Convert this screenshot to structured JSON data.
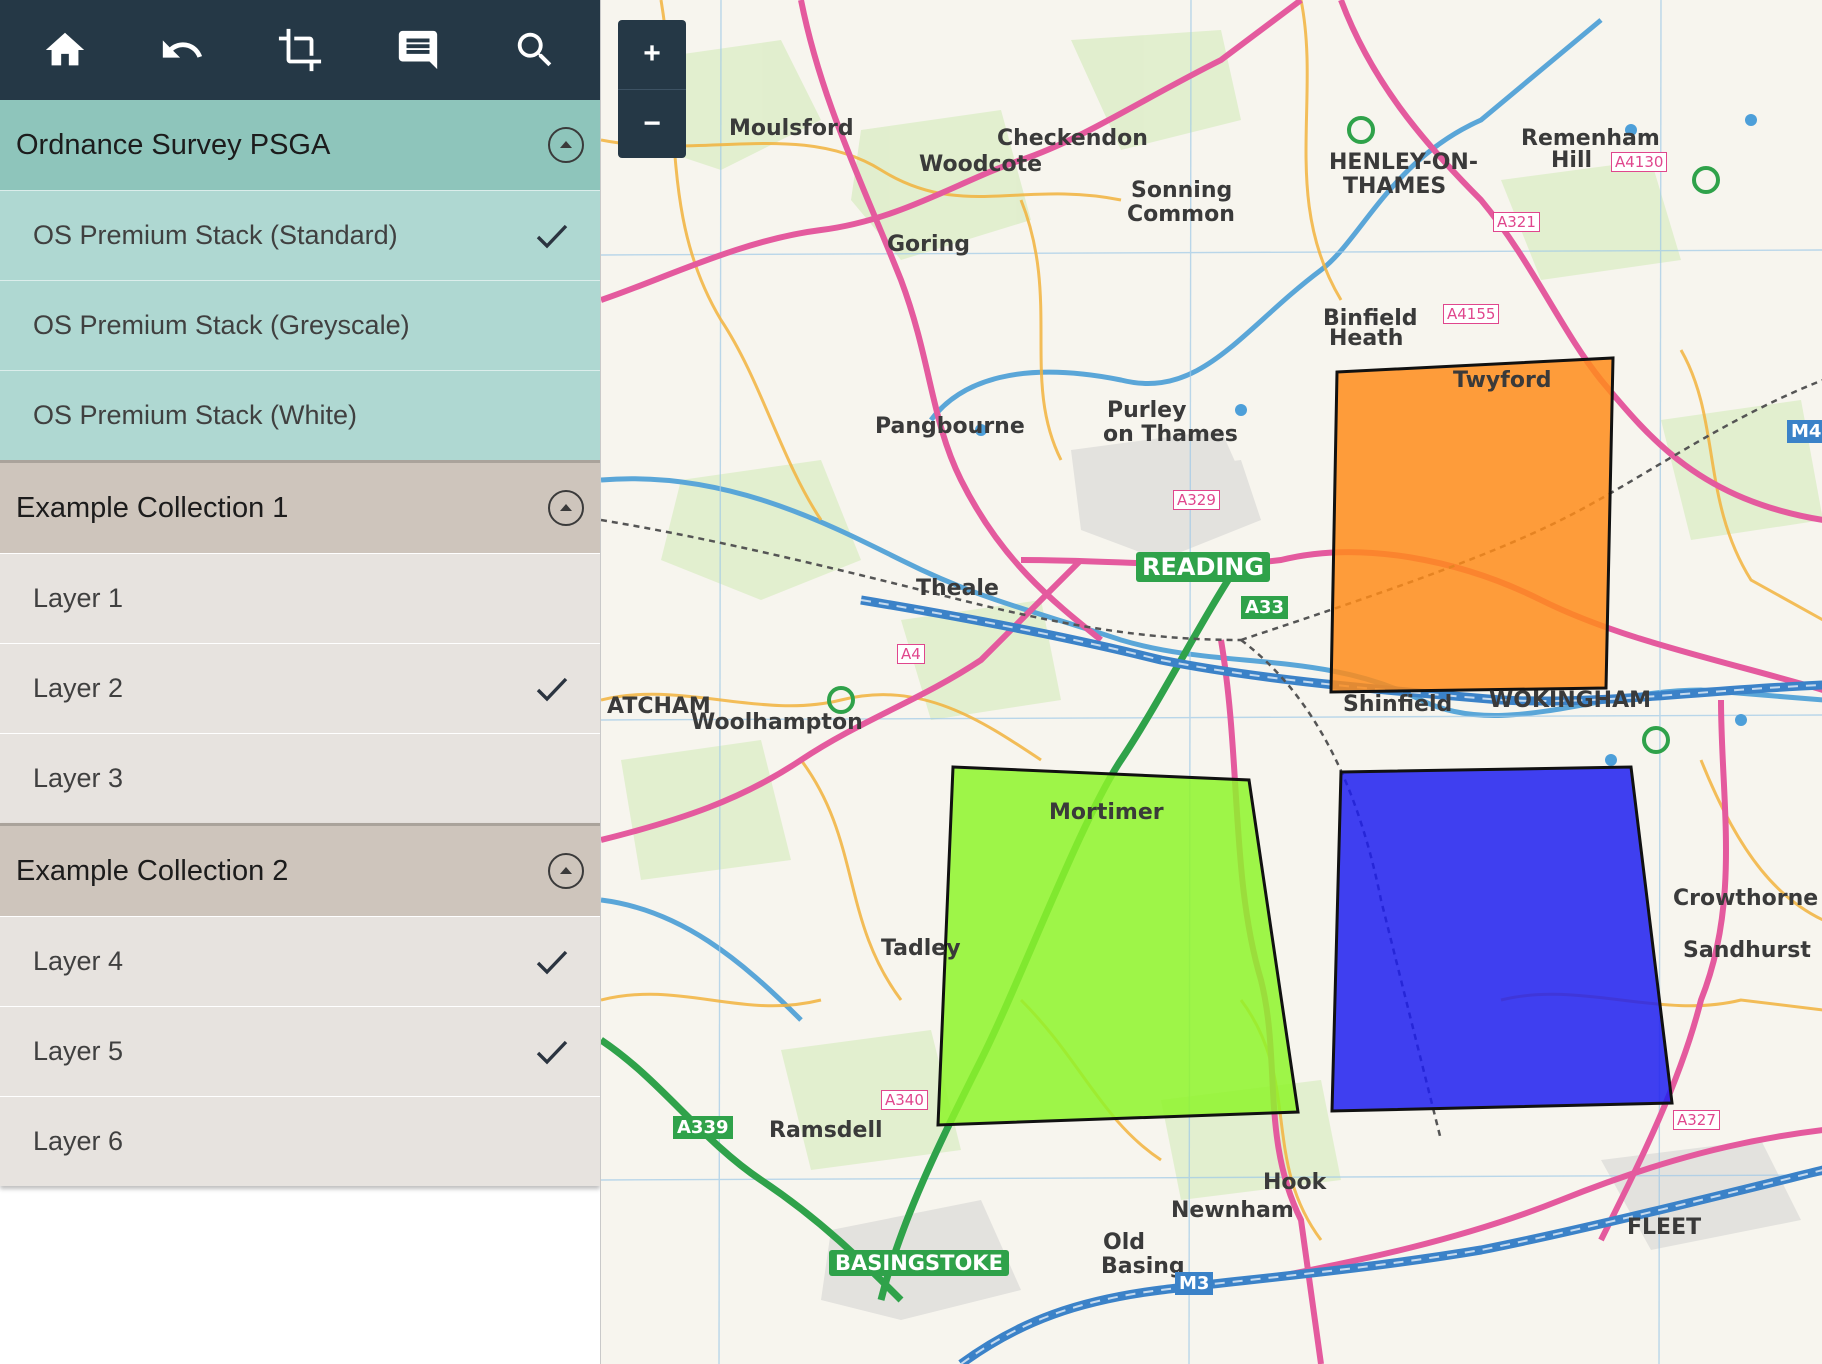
{
  "toolbar": {
    "icons": [
      "home-icon",
      "undo-icon",
      "crop-icon",
      "comment-icon",
      "search-icon"
    ]
  },
  "groups": [
    {
      "title": "Ordnance Survey PSGA",
      "layers": [
        {
          "label": "OS Premium Stack (Standard)",
          "checked": true
        },
        {
          "label": "OS Premium Stack (Greyscale)",
          "checked": false
        },
        {
          "label": "OS Premium Stack (White)",
          "checked": false
        }
      ]
    },
    {
      "title": "Example Collection 1",
      "layers": [
        {
          "label": "Layer 1",
          "checked": false
        },
        {
          "label": "Layer 2",
          "checked": true
        },
        {
          "label": "Layer 3",
          "checked": false
        }
      ]
    },
    {
      "title": "Example Collection 2",
      "layers": [
        {
          "label": "Layer 4",
          "checked": true
        },
        {
          "label": "Layer 5",
          "checked": true
        },
        {
          "label": "Layer 6",
          "checked": false
        }
      ]
    }
  ],
  "map": {
    "zoom_in": "+",
    "zoom_out": "−",
    "labels": {
      "reading": "READING",
      "basingstoke": "BASINGSTOKE",
      "henley": "HENLEY-ON-",
      "thames": "THAMES",
      "sonning": "Sonning",
      "common": "Common",
      "theale": "Theale",
      "purley": "Purley",
      "onthames": "on Thames",
      "pangbourne": "Pangbourne",
      "goring": "Goring",
      "mortimer": "Mortimer",
      "tadley": "Tadley",
      "hook": "Hook",
      "fleet": "FLEET",
      "twyford": "Twyford",
      "shinfield": "Shinfield",
      "wokingham": "WOKINGHAM",
      "crowthorne": "Crowthorne",
      "sandhurst": "Sandhurst",
      "binfield": "Binfield",
      "oldbasing": "Old",
      "basing": "Basing",
      "ramsdell": "Ramsdell",
      "mousford": "Moulsford",
      "atcham": "ATCHAM",
      "woolhampton": "Woolhampton",
      "remenham": "Remenham",
      "hill": "Hill",
      "woodcote": "Woodcote",
      "checkendon": "Checkendon",
      "newnham": "Newnham",
      "binfieldheath": "Heath"
    },
    "roads": [
      "A329",
      "A33",
      "A339",
      "M3",
      "M4",
      "A4",
      "A321",
      "A4155",
      "A4130",
      "A340",
      "A327"
    ],
    "overlays": [
      {
        "name": "orange-polygon",
        "color": "#ff8c1a"
      },
      {
        "name": "green-polygon",
        "color": "#8ef52a"
      },
      {
        "name": "blue-polygon",
        "color": "#1f1ff0"
      }
    ]
  }
}
